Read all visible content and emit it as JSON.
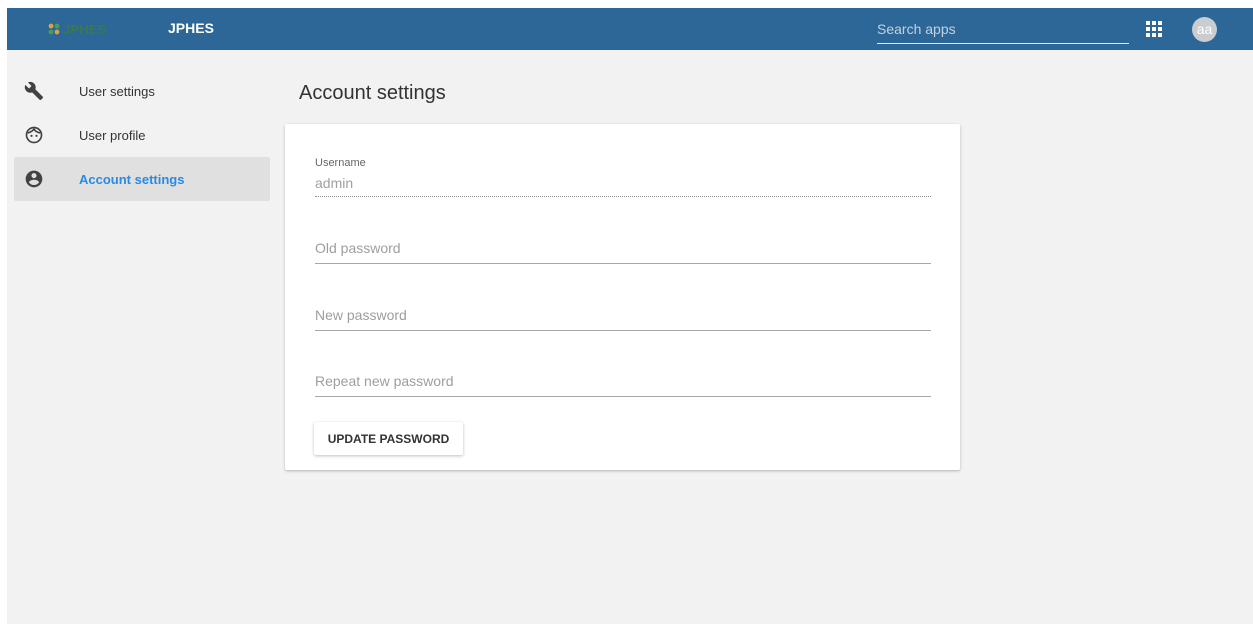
{
  "header": {
    "logo_text": "JPHES",
    "app_title": "JPHES",
    "search_placeholder": "Search apps",
    "avatar_initials": "aa"
  },
  "sidebar": {
    "items": [
      {
        "label": "User settings",
        "icon": "wrench-icon",
        "active": false
      },
      {
        "label": "User profile",
        "icon": "face-icon",
        "active": false
      },
      {
        "label": "Account settings",
        "icon": "account-circle-icon",
        "active": true
      }
    ]
  },
  "main": {
    "title": "Account settings",
    "form": {
      "username_label": "Username",
      "username_value": "admin",
      "old_password_placeholder": "Old password",
      "new_password_placeholder": "New password",
      "repeat_password_placeholder": "Repeat new password",
      "submit_label": "UPDATE PASSWORD"
    }
  },
  "colors": {
    "topbar": "#2c6797",
    "accent": "#2a8ae0",
    "background": "#f2f2f2"
  }
}
